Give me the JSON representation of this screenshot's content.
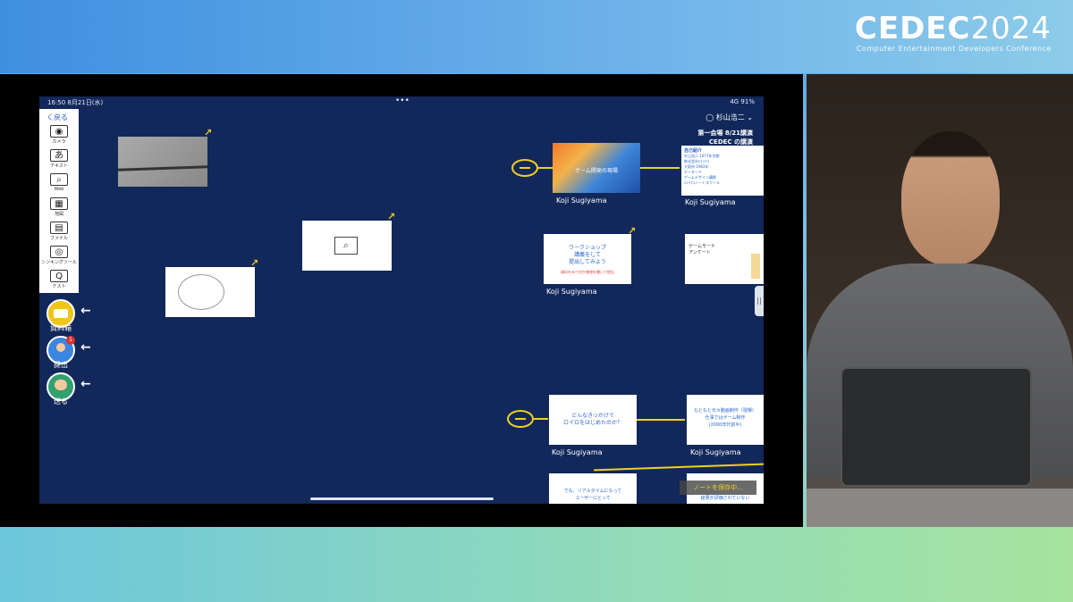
{
  "event": {
    "logo_bold": "CEDEC",
    "logo_year": "2024",
    "subtitle": "Computer Entertainment Developers Conference"
  },
  "status": {
    "time_date": "16:50  8月21日(水)",
    "dots": "•••",
    "right": "4G  91%"
  },
  "toolbar": {
    "back_label": "く戻る",
    "tools": [
      {
        "label": "カメラ",
        "icon": "camera-icon",
        "glyph": "◉"
      },
      {
        "label": "テキスト",
        "icon": "text-icon",
        "glyph": "あ"
      },
      {
        "label": "Web",
        "icon": "web-icon",
        "glyph": "⌕"
      },
      {
        "label": "地図",
        "icon": "map-icon",
        "glyph": "▦"
      },
      {
        "label": "ファイル",
        "icon": "file-icon",
        "glyph": "▤"
      },
      {
        "label": "シンキングツール",
        "icon": "thinking-tool-icon",
        "glyph": "◎"
      },
      {
        "label": "テスト",
        "icon": "test-icon",
        "glyph": "Q"
      }
    ]
  },
  "side_buttons": [
    {
      "label": "資料箱",
      "color": "#f0c419"
    },
    {
      "label": "提出",
      "color": "#3b86e0",
      "badge": "1"
    },
    {
      "label": "送る",
      "color": "#33a070"
    }
  ],
  "header": {
    "user": "杉山浩二",
    "line1": "第一会場 8/21講演",
    "line2": "CEDEC の講演"
  },
  "cards": {
    "slide1_text": "ゲーム開発の現場",
    "intro_title": "自己紹介",
    "intro_lines": [
      "杉山浩二 1977年京都",
      "株式会社ロイロ",
      "大阪府 1983年",
      "データード",
      "ゲームデザイン講師",
      "ロイロノートスクール"
    ],
    "ws_title": "ワークショップ\n講義をして\n提出してみよう",
    "ws_sub": "資料をみて何か感想を書いて提出",
    "survey_title": "ゲームモード\nアンケート",
    "q1": "どんなきっかけで\nロイロをはじめたのか？",
    "q2": "もともと元々動画制作（現場）\n仕事ではゲーム制作\n(2000年代前半)",
    "q3": "でも、リアルタイムになって\nユーザーにとって",
    "q4_sub": "結果が評価されていない"
  },
  "author_labels": [
    "Koji Sugiyama",
    "Koji Sugiyama",
    "Koji Sugiyama",
    "Koji Sugiyama",
    "Koji Sugiyama"
  ],
  "overlay_text": "ノートを保存中...",
  "colors": {
    "canvas": "#12285a",
    "accent": "#f2d01f",
    "link": "#2a66c8"
  }
}
